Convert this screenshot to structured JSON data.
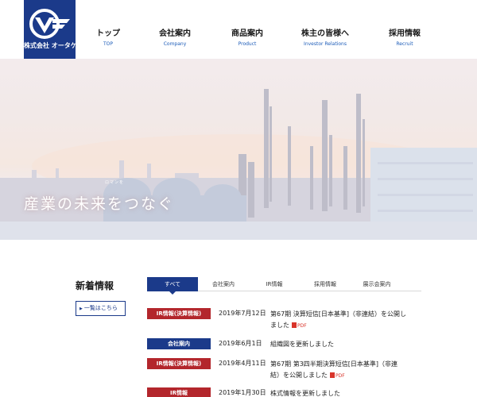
{
  "logo": {
    "text": "株式会社 オータケ"
  },
  "nav": [
    {
      "jp": "トップ",
      "en": "TOP"
    },
    {
      "jp": "会社案内",
      "en": "Company"
    },
    {
      "jp": "商品案内",
      "en": "Product"
    },
    {
      "jp": "株主の皆様へ",
      "en": "Investor Relations"
    },
    {
      "jp": "採用情報",
      "en": "Recruit"
    }
  ],
  "hero": {
    "sub": "ロマンを",
    "catch": "産業の未来をつなぐ"
  },
  "news": {
    "title": "新着情報",
    "more": "一覧はこちら",
    "tabs": [
      "すべて",
      "会社案内",
      "IR情報",
      "採用情報",
      "展示会案内"
    ],
    "active_tab": "すべて",
    "items": [
      {
        "badge": "IR情報(決算情報)",
        "badge_color": "#b3262c",
        "date": "2019年7月12日",
        "text": "第67期 決算短信[日本基準]（非連結）を公開しました",
        "pdf": "PDF"
      },
      {
        "badge": "会社案内",
        "badge_color": "#1b3a8a",
        "date": "2019年6月1日",
        "text": "組織図を更新しました",
        "pdf": ""
      },
      {
        "badge": "IR情報(決算情報)",
        "badge_color": "#b3262c",
        "date": "2019年4月11日",
        "text": "第67期 第3四半期決算短信[日本基準]（非連結）を公開しました",
        "pdf": "PDF"
      },
      {
        "badge": "IR情報",
        "badge_color": "#b3262c",
        "date": "2019年1月30日",
        "text": "株式情報を更新しました",
        "pdf": ""
      }
    ]
  },
  "colors": {
    "brand": "#1b3a8a",
    "ir_red": "#b3262c",
    "pdf_red": "#d9342b"
  }
}
